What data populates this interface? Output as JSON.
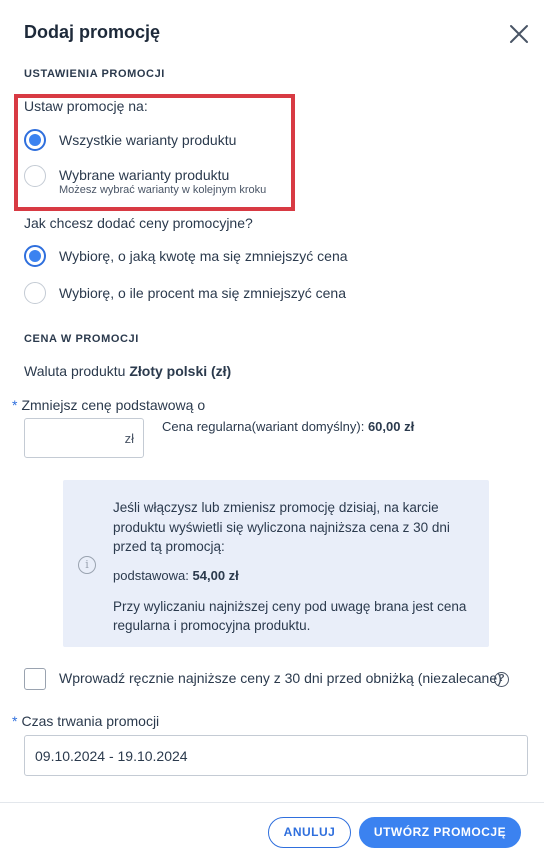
{
  "dialog": {
    "title": "Dodaj promocję"
  },
  "settings": {
    "section_label": "USTAWIENIA PROMOCJI",
    "set_on_label": "Ustaw promocję na:",
    "variant_options": [
      {
        "label": "Wszystkie warianty produktu",
        "hint": "",
        "checked": true
      },
      {
        "label": "Wybrane warianty produktu",
        "hint": "Możesz wybrać warianty w kolejnym kroku",
        "checked": false
      }
    ],
    "price_method_label": "Jak chcesz dodać ceny promocyjne?",
    "price_options": [
      {
        "label": "Wybiorę, o jaką kwotę ma się zmniejszyć cena",
        "checked": true
      },
      {
        "label": "Wybiorę, o ile procent ma się zmniejszyć cena",
        "checked": false
      }
    ]
  },
  "price": {
    "section_label": "CENA W PROMOCJI",
    "currency_prefix": "Waluta produktu",
    "currency_name": "Złoty polski (zł)",
    "required_mark": "*",
    "reduce_label": "Zmniejsz cenę podstawową o",
    "reduce_value": "",
    "currency_unit": "zł",
    "regular_price_label": "Cena regularna(wariant domyślny):",
    "regular_price_value": "60,00 zł"
  },
  "info": {
    "icon": "info-icon",
    "lines": [
      "Jeśli włączysz lub zmienisz promocję dzisiaj, na karcie",
      "produktu wyświetli się wyliczona najniższa cena z 30 dni",
      "przed tą promocją:"
    ],
    "base_label": "podstawowa:",
    "base_value": "54,00 zł",
    "note_lines": [
      "Przy wyliczaniu najniższej ceny pod uwagę brana jest cena",
      "regularna i promocyjna produktu."
    ]
  },
  "manual": {
    "label": "Wprowadź ręcznie najniższe ceny z 30 dni przed obniżką (niezalecane)",
    "checked": false,
    "help_icon": "?"
  },
  "duration": {
    "required_mark": "*",
    "label": "Czas trwania promocji",
    "value": "09.10.2024 - 19.10.2024"
  },
  "footer": {
    "cancel_label": "ANULUJ",
    "create_label": "UTWÓRZ PROMOCJĘ"
  },
  "colors": {
    "accent": "#3b82f0",
    "highlight_border": "#d83a43",
    "info_bg": "#e9eef9"
  }
}
